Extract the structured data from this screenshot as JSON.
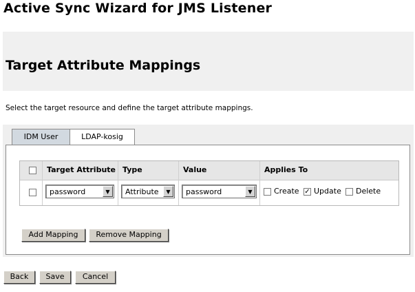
{
  "page": {
    "wizard_title": "Active Sync Wizard for JMS Listener",
    "section_title": "Target Attribute Mappings",
    "instructions": "Select the target resource and define the target attribute mappings."
  },
  "tabs": [
    {
      "label": "IDM User",
      "selected": false
    },
    {
      "label": "LDAP-kosig",
      "selected": true
    }
  ],
  "table": {
    "headers": {
      "target_attribute": "Target Attribute",
      "type": "Type",
      "value": "Value",
      "applies_to": "Applies To"
    },
    "rows": [
      {
        "selected": false,
        "target_attribute": "password",
        "type": "Attribute",
        "value": "password",
        "applies_to": {
          "create_label": "Create",
          "create": false,
          "update_label": "Update",
          "update": true,
          "delete_label": "Delete",
          "delete": false
        }
      }
    ]
  },
  "buttons": {
    "add_mapping": "Add Mapping",
    "remove_mapping": "Remove Mapping",
    "back": "Back",
    "save": "Save",
    "cancel": "Cancel"
  },
  "colors": {
    "banner_bg": "#f0f0f0",
    "panel_bg": "#efefef",
    "inactive_tab_bg": "#d2d9e0",
    "table_header_bg": "#e6e6e6",
    "button_bg": "#d4d0c8"
  }
}
